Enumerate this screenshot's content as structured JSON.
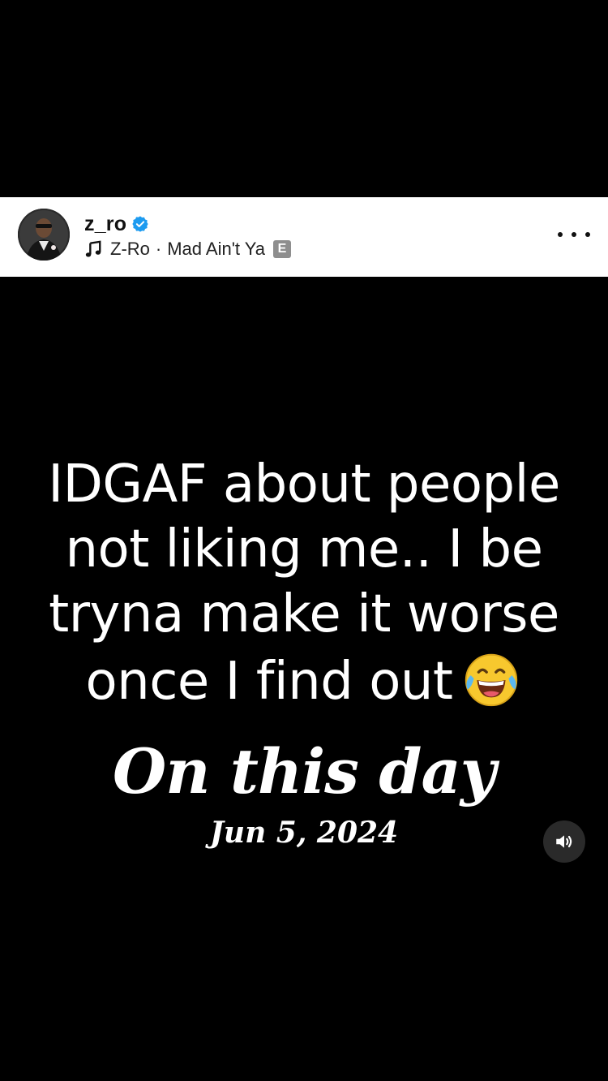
{
  "post": {
    "username": "z_ro",
    "verified": true,
    "music": {
      "artist": "Z-Ro",
      "separator": "·",
      "title": "Mad Ain't Ya",
      "explicit_badge": "E"
    },
    "more_icon": "more-horizontal-icon"
  },
  "media": {
    "quote_lines": [
      "IDGAF about people",
      "not liking me.. I be",
      "tryna make it worse",
      "once I find out"
    ],
    "quote_emoji": "face-with-tears-of-joy",
    "on_this_day_label": "On this day",
    "on_this_day_date": "Jun 5, 2024",
    "sound_icon": "speaker-on-icon"
  },
  "colors": {
    "background": "#000000",
    "header_background": "#ffffff",
    "verified_blue": "#1d9bf0",
    "emoji_yellow": "#f7c82e"
  }
}
